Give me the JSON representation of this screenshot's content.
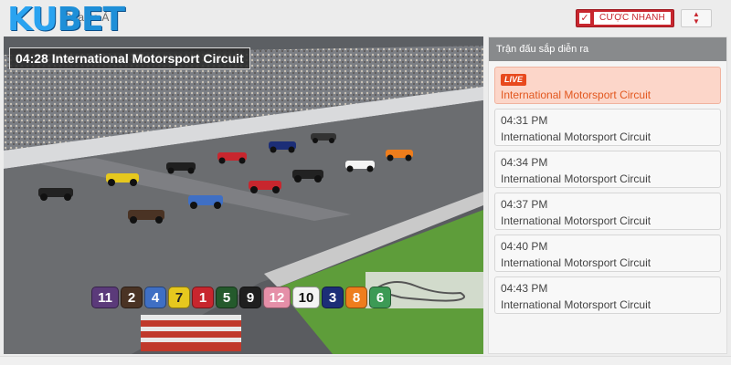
{
  "header": {
    "logo_prefix": "KU",
    "logo_suffix": "BET",
    "breadcrumb": "Đua xe Ả",
    "quick_bet_label": "CƯỢC NHANH",
    "quick_bet_checked": true
  },
  "video": {
    "title": "04:28 International Motorsport Circuit",
    "numbers": [
      {
        "n": "11",
        "bg": "#5b3a7a",
        "fg": "#ffffff"
      },
      {
        "n": "2",
        "bg": "#4a3324",
        "fg": "#ffffff"
      },
      {
        "n": "4",
        "bg": "#3f6fc4",
        "fg": "#ffffff"
      },
      {
        "n": "7",
        "bg": "#e6c81e",
        "fg": "#222222"
      },
      {
        "n": "1",
        "bg": "#c8262e",
        "fg": "#ffffff"
      },
      {
        "n": "5",
        "bg": "#245a2c",
        "fg": "#ffffff"
      },
      {
        "n": "9",
        "bg": "#1f1f1f",
        "fg": "#ffffff"
      },
      {
        "n": "12",
        "bg": "#e58fa8",
        "fg": "#ffffff"
      },
      {
        "n": "10",
        "bg": "#f4f4f4",
        "fg": "#111111"
      },
      {
        "n": "3",
        "bg": "#1c2e77",
        "fg": "#ffffff"
      },
      {
        "n": "8",
        "bg": "#ee7d1c",
        "fg": "#ffffff"
      },
      {
        "n": "6",
        "bg": "#3c9a55",
        "fg": "#ffffff"
      }
    ]
  },
  "sidebar": {
    "title": "Trận đấu sắp diễn ra",
    "live_badge": "LIVE",
    "races": [
      {
        "time": "",
        "name": "International Motorsport Circuit",
        "live": true
      },
      {
        "time": "04:31 PM",
        "name": "International Motorsport Circuit",
        "live": false
      },
      {
        "time": "04:34 PM",
        "name": "International Motorsport Circuit",
        "live": false
      },
      {
        "time": "04:37 PM",
        "name": "International Motorsport Circuit",
        "live": false
      },
      {
        "time": "04:40 PM",
        "name": "International Motorsport Circuit",
        "live": false
      },
      {
        "time": "04:43 PM",
        "name": "International Motorsport Circuit",
        "live": false
      }
    ]
  },
  "colors": {
    "accent_red": "#c8262e",
    "live_orange": "#e8491d",
    "live_bg": "#fcd6c9",
    "logo_blue": "#1e8fd8"
  }
}
